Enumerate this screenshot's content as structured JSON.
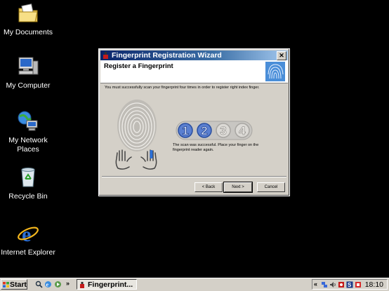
{
  "desktop": {
    "icons": [
      {
        "label": "My Documents"
      },
      {
        "label": "My Computer"
      },
      {
        "label": "My Network Places"
      },
      {
        "label": "Recycle Bin"
      },
      {
        "label": "Internet Explorer"
      }
    ]
  },
  "wizard": {
    "title": "Fingerprint Registration Wizard",
    "close_label": "✕",
    "header_title": "Register a Fingerprint",
    "instruction": "You must successfully scan your fingerprint four times in order to register right index finger.",
    "steps": [
      "1",
      "2",
      "3",
      "4"
    ],
    "completed_steps": 2,
    "status": "The scan was successful. Place your finger on the fingerprint reader again.",
    "buttons": {
      "back": "< Back",
      "next": "Next >",
      "cancel": "Cancel"
    },
    "accent": "#5a7fd0"
  },
  "taskbar": {
    "start_label": "Start",
    "quick_chevron": "»",
    "task_label": "Fingerprint...",
    "tray_chevron": "«",
    "clock": "18:10"
  }
}
